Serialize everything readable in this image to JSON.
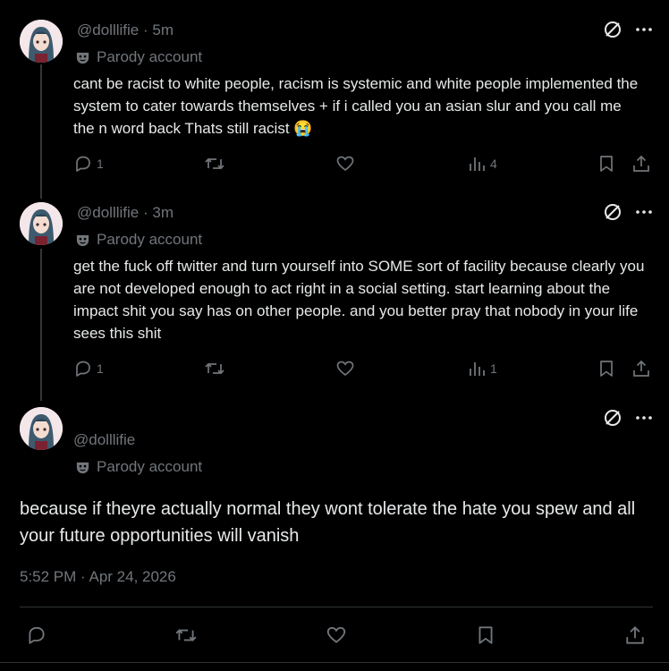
{
  "posts": [
    {
      "handle": "@dolllifie",
      "time_sep": "·",
      "time": "5m",
      "badge": "Parody account",
      "text": "cant be racist to white people, racism is systemic and white people implemented the system to cater towards themselves + if i called you an asian slur and you call me the n word back Thats still racist 😭",
      "replies": "1",
      "views": "4"
    },
    {
      "handle": "@dolllifie",
      "time_sep": "·",
      "time": "3m",
      "badge": "Parody account",
      "text": "get the fuck off twitter and turn yourself into SOME sort of facility because clearly you are not developed enough to act right in a social setting. start learning about the impact shit you say has on other people. and you better pray that nobody in your life sees this shit",
      "replies": "1",
      "views": "1"
    }
  ],
  "main_post": {
    "handle": "@dolllifie",
    "badge": "Parody account",
    "text": "because if theyre actually normal they wont tolerate the hate you spew and all your future opportunities will vanish",
    "timestamp": "5:52 PM · Apr 24, 2026"
  },
  "colors": {
    "background": "#000000",
    "text": "#e7e9ea",
    "muted": "#71767b",
    "border": "#2f3336"
  },
  "icons": [
    "no-entry-icon",
    "more-icon",
    "parody-mask-icon",
    "reply-icon",
    "repost-icon",
    "like-icon",
    "views-icon",
    "bookmark-icon",
    "share-icon"
  ]
}
